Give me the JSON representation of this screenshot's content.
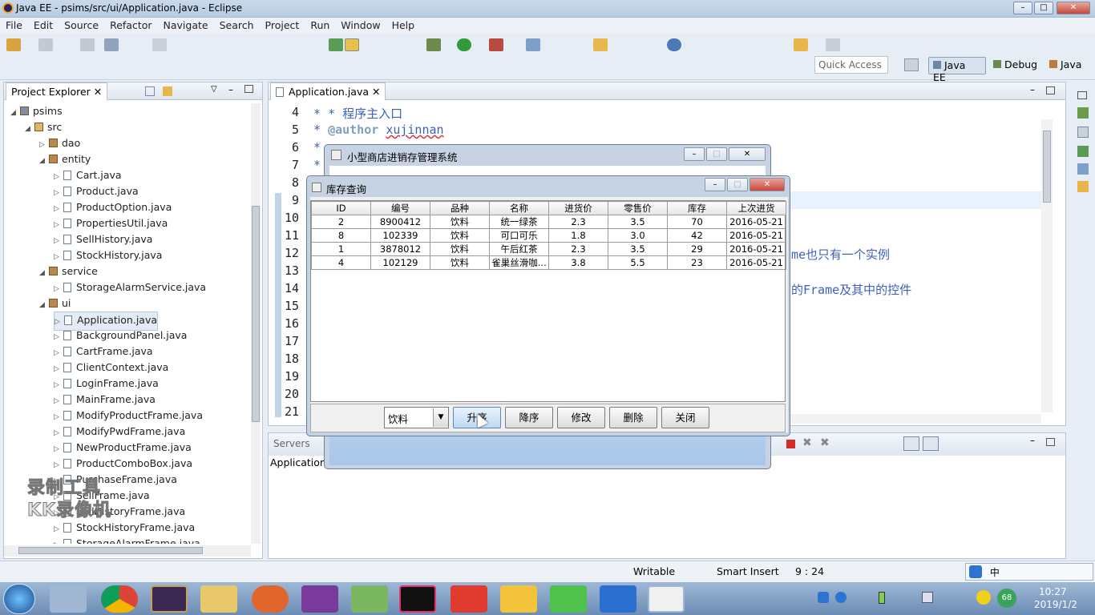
{
  "window": {
    "title": "Java EE - psims/src/ui/Application.java - Eclipse"
  },
  "menu": [
    "File",
    "Edit",
    "Source",
    "Refactor",
    "Navigate",
    "Search",
    "Project",
    "Run",
    "Window",
    "Help"
  ],
  "quick_access": "Quick Access",
  "perspectives": [
    "Java EE",
    "Debug",
    "Java"
  ],
  "explorer": {
    "tab": "Project Explorer",
    "items": [
      {
        "label": "psims",
        "kind": "project",
        "depth": 0
      },
      {
        "label": "src",
        "kind": "folder",
        "depth": 1
      },
      {
        "label": "dao",
        "kind": "package",
        "depth": 2
      },
      {
        "label": "entity",
        "kind": "package",
        "depth": 2
      },
      {
        "label": "Cart.java",
        "kind": "file",
        "depth": 3
      },
      {
        "label": "Product.java",
        "kind": "file",
        "depth": 3
      },
      {
        "label": "ProductOption.java",
        "kind": "file",
        "depth": 3
      },
      {
        "label": "PropertiesUtil.java",
        "kind": "file",
        "depth": 3
      },
      {
        "label": "SellHistory.java",
        "kind": "file",
        "depth": 3
      },
      {
        "label": "StockHistory.java",
        "kind": "file",
        "depth": 3
      },
      {
        "label": "service",
        "kind": "package",
        "depth": 2
      },
      {
        "label": "StorageAlarmService.java",
        "kind": "file",
        "depth": 3
      },
      {
        "label": "ui",
        "kind": "package",
        "depth": 2
      },
      {
        "label": "Application.java",
        "kind": "file",
        "depth": 3
      },
      {
        "label": "BackgroundPanel.java",
        "kind": "file",
        "depth": 3
      },
      {
        "label": "CartFrame.java",
        "kind": "file",
        "depth": 3
      },
      {
        "label": "ClientContext.java",
        "kind": "file",
        "depth": 3
      },
      {
        "label": "LoginFrame.java",
        "kind": "file",
        "depth": 3
      },
      {
        "label": "MainFrame.java",
        "kind": "file",
        "depth": 3
      },
      {
        "label": "ModifyProductFrame.java",
        "kind": "file",
        "depth": 3
      },
      {
        "label": "ModifyPwdFrame.java",
        "kind": "file",
        "depth": 3
      },
      {
        "label": "NewProductFrame.java",
        "kind": "file",
        "depth": 3
      },
      {
        "label": "ProductComboBox.java",
        "kind": "file",
        "depth": 3
      },
      {
        "label": "PurchaseFrame.java",
        "kind": "file",
        "depth": 3
      },
      {
        "label": "SellFrame.java",
        "kind": "file",
        "depth": 3
      },
      {
        "label": "SellHistoryFrame.java",
        "kind": "file",
        "depth": 3
      },
      {
        "label": "StockHistoryFrame.java",
        "kind": "file",
        "depth": 3
      },
      {
        "label": "StorageAlarmFrame.java",
        "kind": "file",
        "depth": 3
      }
    ]
  },
  "editor": {
    "tab": "Application.java",
    "line_numbers": [
      "4",
      "5",
      "6",
      "7",
      "8",
      "9",
      "10",
      "11",
      "12",
      "13",
      "14",
      "15",
      "16",
      "17",
      "18",
      "19",
      "20",
      "21"
    ],
    "line4": "* 程序主入口",
    "line5_tag": "@author",
    "line5_name": "xujinnan",
    "line6": "*",
    "line7": "*",
    "line12_frag": "me也只有一个实例",
    "line14_frag": "的Frame及其中的控件"
  },
  "bottom": {
    "tab": "Servers",
    "sub": "Application"
  },
  "watermark": "录制工具 KK录像机",
  "main_window": {
    "title": "小型商店进销存管理系统"
  },
  "stock_dialog": {
    "title": "库存查询",
    "columns": [
      "ID",
      "编号",
      "品种",
      "名称",
      "进货价",
      "零售价",
      "库存",
      "上次进货"
    ],
    "rows": [
      [
        "2",
        "8900412",
        "饮料",
        "统一绿茶",
        "2.3",
        "3.5",
        "70",
        "2016-05-21"
      ],
      [
        "8",
        "102339",
        "饮料",
        "可口可乐",
        "1.8",
        "3.0",
        "42",
        "2016-05-21"
      ],
      [
        "1",
        "3878012",
        "饮料",
        "午后红茶",
        "2.3",
        "3.5",
        "29",
        "2016-05-21"
      ],
      [
        "4",
        "102129",
        "饮料",
        "雀巢丝滑咖...",
        "3.8",
        "5.5",
        "23",
        "2016-05-21"
      ]
    ],
    "category": "饮料",
    "buttons": {
      "asc": "升序",
      "desc": "降序",
      "edit": "修改",
      "delete": "删除",
      "close": "关闭"
    }
  },
  "status": {
    "writable": "Writable",
    "insert": "Smart Insert",
    "pos": "9 : 24"
  },
  "tray": {
    "time": "10:27",
    "date": "2019/1/2",
    "battery": "68",
    "ime": "中"
  }
}
